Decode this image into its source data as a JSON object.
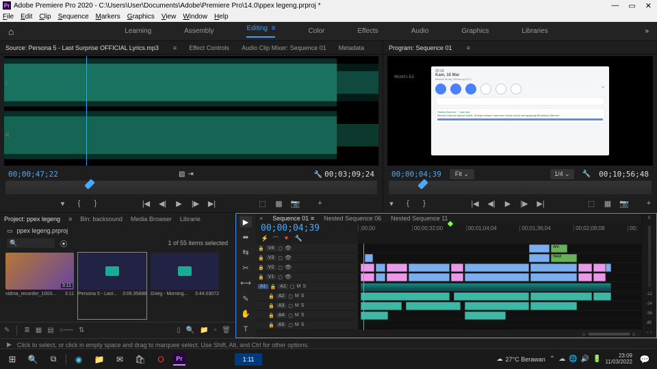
{
  "title": "Adobe Premiere Pro 2020 - C:\\Users\\User\\Documents\\Adobe\\Premiere Pro\\14.0\\ppex legeng.prproj *",
  "menu": [
    "File",
    "Edit",
    "Clip",
    "Sequence",
    "Markers",
    "Graphics",
    "View",
    "Window",
    "Help"
  ],
  "workspaces": {
    "items": [
      "Learning",
      "Assembly",
      "Editing",
      "Color",
      "Effects",
      "Audio",
      "Graphics",
      "Libraries"
    ],
    "active": "Editing"
  },
  "source_panel": {
    "tabs": [
      "Source: Persona 5 - Last Surprise OFFICIAL Lyrics.mp3",
      "Effect Controls",
      "Audio Clip Mixer: Sequence 01",
      "Metadata"
    ],
    "timecode_in": "00;00;47;22",
    "timecode_out": "00;03;09;24"
  },
  "program_panel": {
    "tab": "Program: Sequence 01",
    "timecode_in": "00;00;04;39",
    "fit": "Fit",
    "zoom": "1/4",
    "timecode_dur": "00;10;56;48",
    "phone": {
      "time": "20:19",
      "date": "Kam, 10 Mar",
      "sub": "Bandar Muaq, Mendung 20°C",
      "card_title": "Sistem Android · 7 jam lalu",
      "card_text": "Memori internal hampir habis. Kinerja telepon menurun!\nKetuk untuk mengunjungi Bersihkan Memori"
    }
  },
  "project_panel": {
    "tabs": [
      "Project: ppex legeng",
      "Bin: backsound",
      "Media Browser",
      "Librarie"
    ],
    "project_name": "ppex legeng.prproj",
    "search_placeholder": "🔍",
    "count": "1 of 55 items selected",
    "items": [
      {
        "name": "vidma_recorder_1003...",
        "dur": "3:11",
        "type": "video"
      },
      {
        "name": "Persona 5 - Last...",
        "dur": "3:09.35888",
        "type": "audio",
        "selected": true
      },
      {
        "name": "Grieg - Morning...",
        "dur": "3:44.03072",
        "type": "audio"
      }
    ]
  },
  "timeline": {
    "tabs": [
      "Sequence 01",
      "Nested Sequence 06",
      "Nested Sequence 11"
    ],
    "timecode": "00;00;04;39",
    "ruler": [
      ";00;00",
      "00;00;32;00",
      "00;01;04;04",
      "00;01;36;04",
      "00;02;08;08",
      "00;"
    ],
    "video_tracks": [
      "V4",
      "V3",
      "V2",
      "V1"
    ],
    "audio_tracks": [
      "A1",
      "A2",
      "A3",
      "A4",
      "A5"
    ],
    "labels": {
      "ani": "Ani",
      "nest": "Nest"
    },
    "a1_tag": "A1",
    "db_labels": [
      "-12",
      "-24",
      "-36",
      "dB"
    ],
    "oo": "○ ○"
  },
  "hint": "Click to select, or click in empty space and drag to marquee select. Use Shift, Alt, and Ctrl for other options.",
  "taskbar": {
    "tile": "1:11",
    "weather": "27°C  Berawan",
    "time": "23:09",
    "date": "11/03/2022"
  }
}
